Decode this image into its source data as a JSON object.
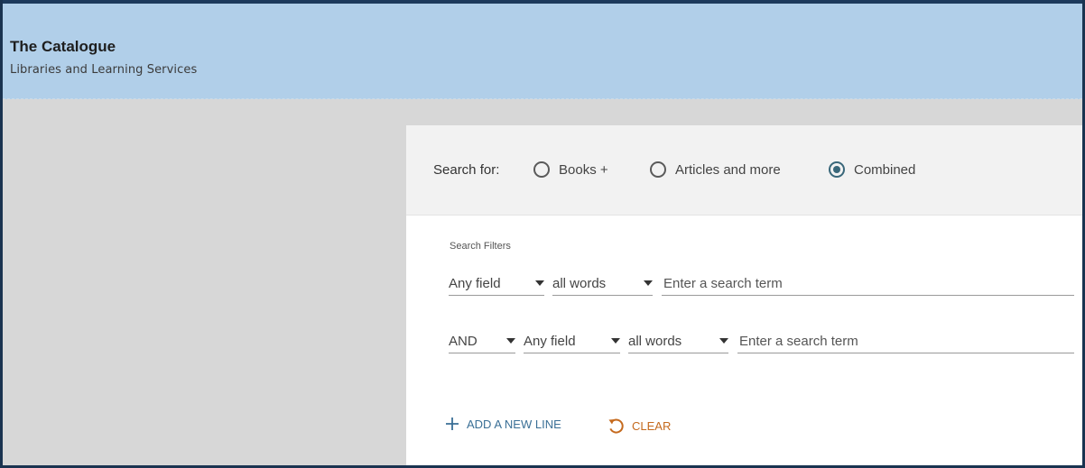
{
  "header": {
    "title": "The Catalogue",
    "subtitle": "Libraries and Learning Services"
  },
  "scope": {
    "label": "Search for:",
    "options": [
      {
        "label": "Books +",
        "checked": false
      },
      {
        "label": "Articles and more",
        "checked": false
      },
      {
        "label": "Combined",
        "checked": true
      }
    ]
  },
  "filters": {
    "label": "Search Filters",
    "rows": [
      {
        "operator": null,
        "field": "Any field",
        "precision": "all words",
        "placeholder": "Enter a search term"
      },
      {
        "operator": "AND",
        "field": "Any field",
        "precision": "all words",
        "placeholder": "Enter a search term"
      }
    ]
  },
  "actions": {
    "add_line": "ADD A NEW LINE",
    "clear": "CLEAR"
  },
  "colors": {
    "header_bg": "#b1cfe9",
    "accent": "#39677a",
    "add_link": "#3a6f96",
    "clear_link": "#c56a1e"
  },
  "icons": {
    "add": "plus-icon",
    "clear": "reset-icon",
    "dropdown": "caret-down-icon"
  }
}
